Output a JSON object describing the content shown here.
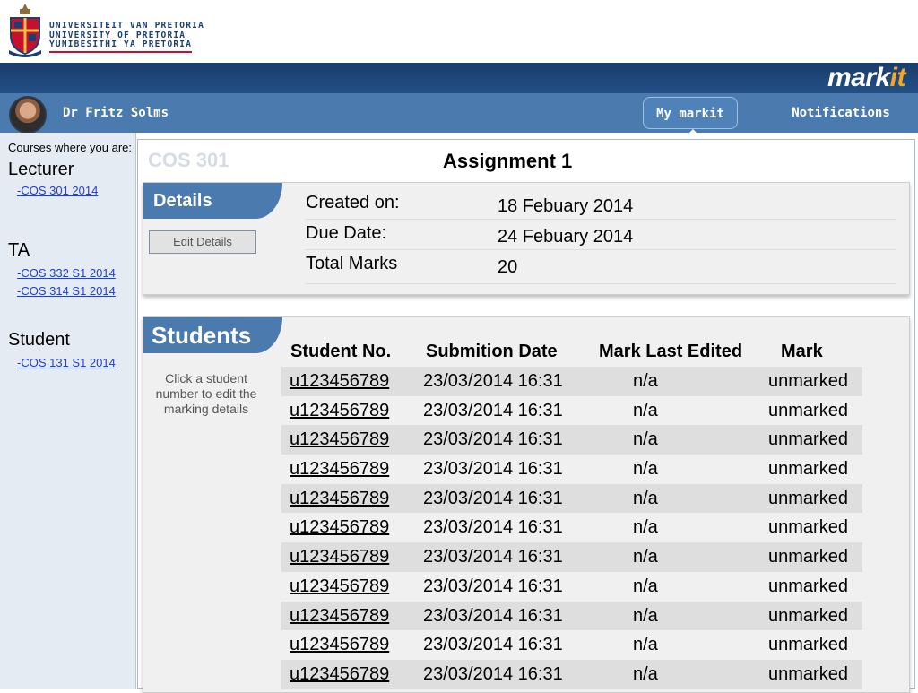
{
  "university": {
    "name_afrikaans": "UNIVERSITEIT VAN PRETORIA",
    "name_english": "UNIVERSITY OF PRETORIA",
    "name_sepedi": "YUNIBESITHI YA PRETORIA"
  },
  "brand": {
    "prefix": "mark",
    "accent": "it"
  },
  "user": {
    "name": "Dr Fritz Solms"
  },
  "nav": {
    "my_markit": "My markit",
    "notifications": "Notifications"
  },
  "sidebar": {
    "caption": "Courses where you are:",
    "lecturer": {
      "label": "Lecturer",
      "courses": [
        "-COS 301 2014"
      ]
    },
    "ta": {
      "label": "TA",
      "courses": [
        "-COS 332 S1 2014",
        "-COS 314 S1 2014"
      ]
    },
    "student": {
      "label": "Student",
      "courses": [
        "-COS 131 S1 2014"
      ]
    }
  },
  "main": {
    "course_code": "COS 301",
    "assignment_title": "Assignment 1"
  },
  "details": {
    "heading": "Details",
    "edit_button": "Edit Details",
    "created_label": "Created on:",
    "created_value": "18 Febuary 2014",
    "due_label": "Due Date:",
    "due_value": "24 Febuary 2014",
    "total_label": "Total Marks",
    "total_value": "20"
  },
  "students": {
    "heading": "Students",
    "hint": "Click a student number to edit the marking details",
    "columns": [
      "Student No.",
      "Submition Date",
      "Mark Last Edited",
      "Mark"
    ],
    "rows": [
      {
        "student_no": "u123456789",
        "submission": "23/03/2014 16:31",
        "edited": "n/a",
        "mark": "unmarked"
      },
      {
        "student_no": "u123456789",
        "submission": "23/03/2014 16:31",
        "edited": "n/a",
        "mark": "unmarked"
      },
      {
        "student_no": "u123456789",
        "submission": "23/03/2014 16:31",
        "edited": "n/a",
        "mark": "unmarked"
      },
      {
        "student_no": "u123456789",
        "submission": "23/03/2014 16:31",
        "edited": "n/a",
        "mark": "unmarked"
      },
      {
        "student_no": "u123456789",
        "submission": "23/03/2014 16:31",
        "edited": "n/a",
        "mark": "unmarked"
      },
      {
        "student_no": "u123456789",
        "submission": "23/03/2014 16:31",
        "edited": "n/a",
        "mark": "unmarked"
      },
      {
        "student_no": "u123456789",
        "submission": "23/03/2014 16:31",
        "edited": "n/a",
        "mark": "unmarked"
      },
      {
        "student_no": "u123456789",
        "submission": "23/03/2014 16:31",
        "edited": "n/a",
        "mark": "unmarked"
      },
      {
        "student_no": "u123456789",
        "submission": "23/03/2014 16:31",
        "edited": "n/a",
        "mark": "unmarked"
      },
      {
        "student_no": "u123456789",
        "submission": "23/03/2014 16:31",
        "edited": "n/a",
        "mark": "unmarked"
      },
      {
        "student_no": "u123456789",
        "submission": "23/03/2014 16:31",
        "edited": "n/a",
        "mark": "unmarked"
      }
    ]
  },
  "colors": {
    "header_dark": "#1a3d6b",
    "nav_blue": "#4a7aae",
    "accent_orange": "#f5a623",
    "link_blue": "#1c3fd4",
    "sidebar_bg": "#e5ebf3"
  },
  "icons": {
    "crest": "university-crest-icon",
    "avatar": "user-avatar"
  }
}
